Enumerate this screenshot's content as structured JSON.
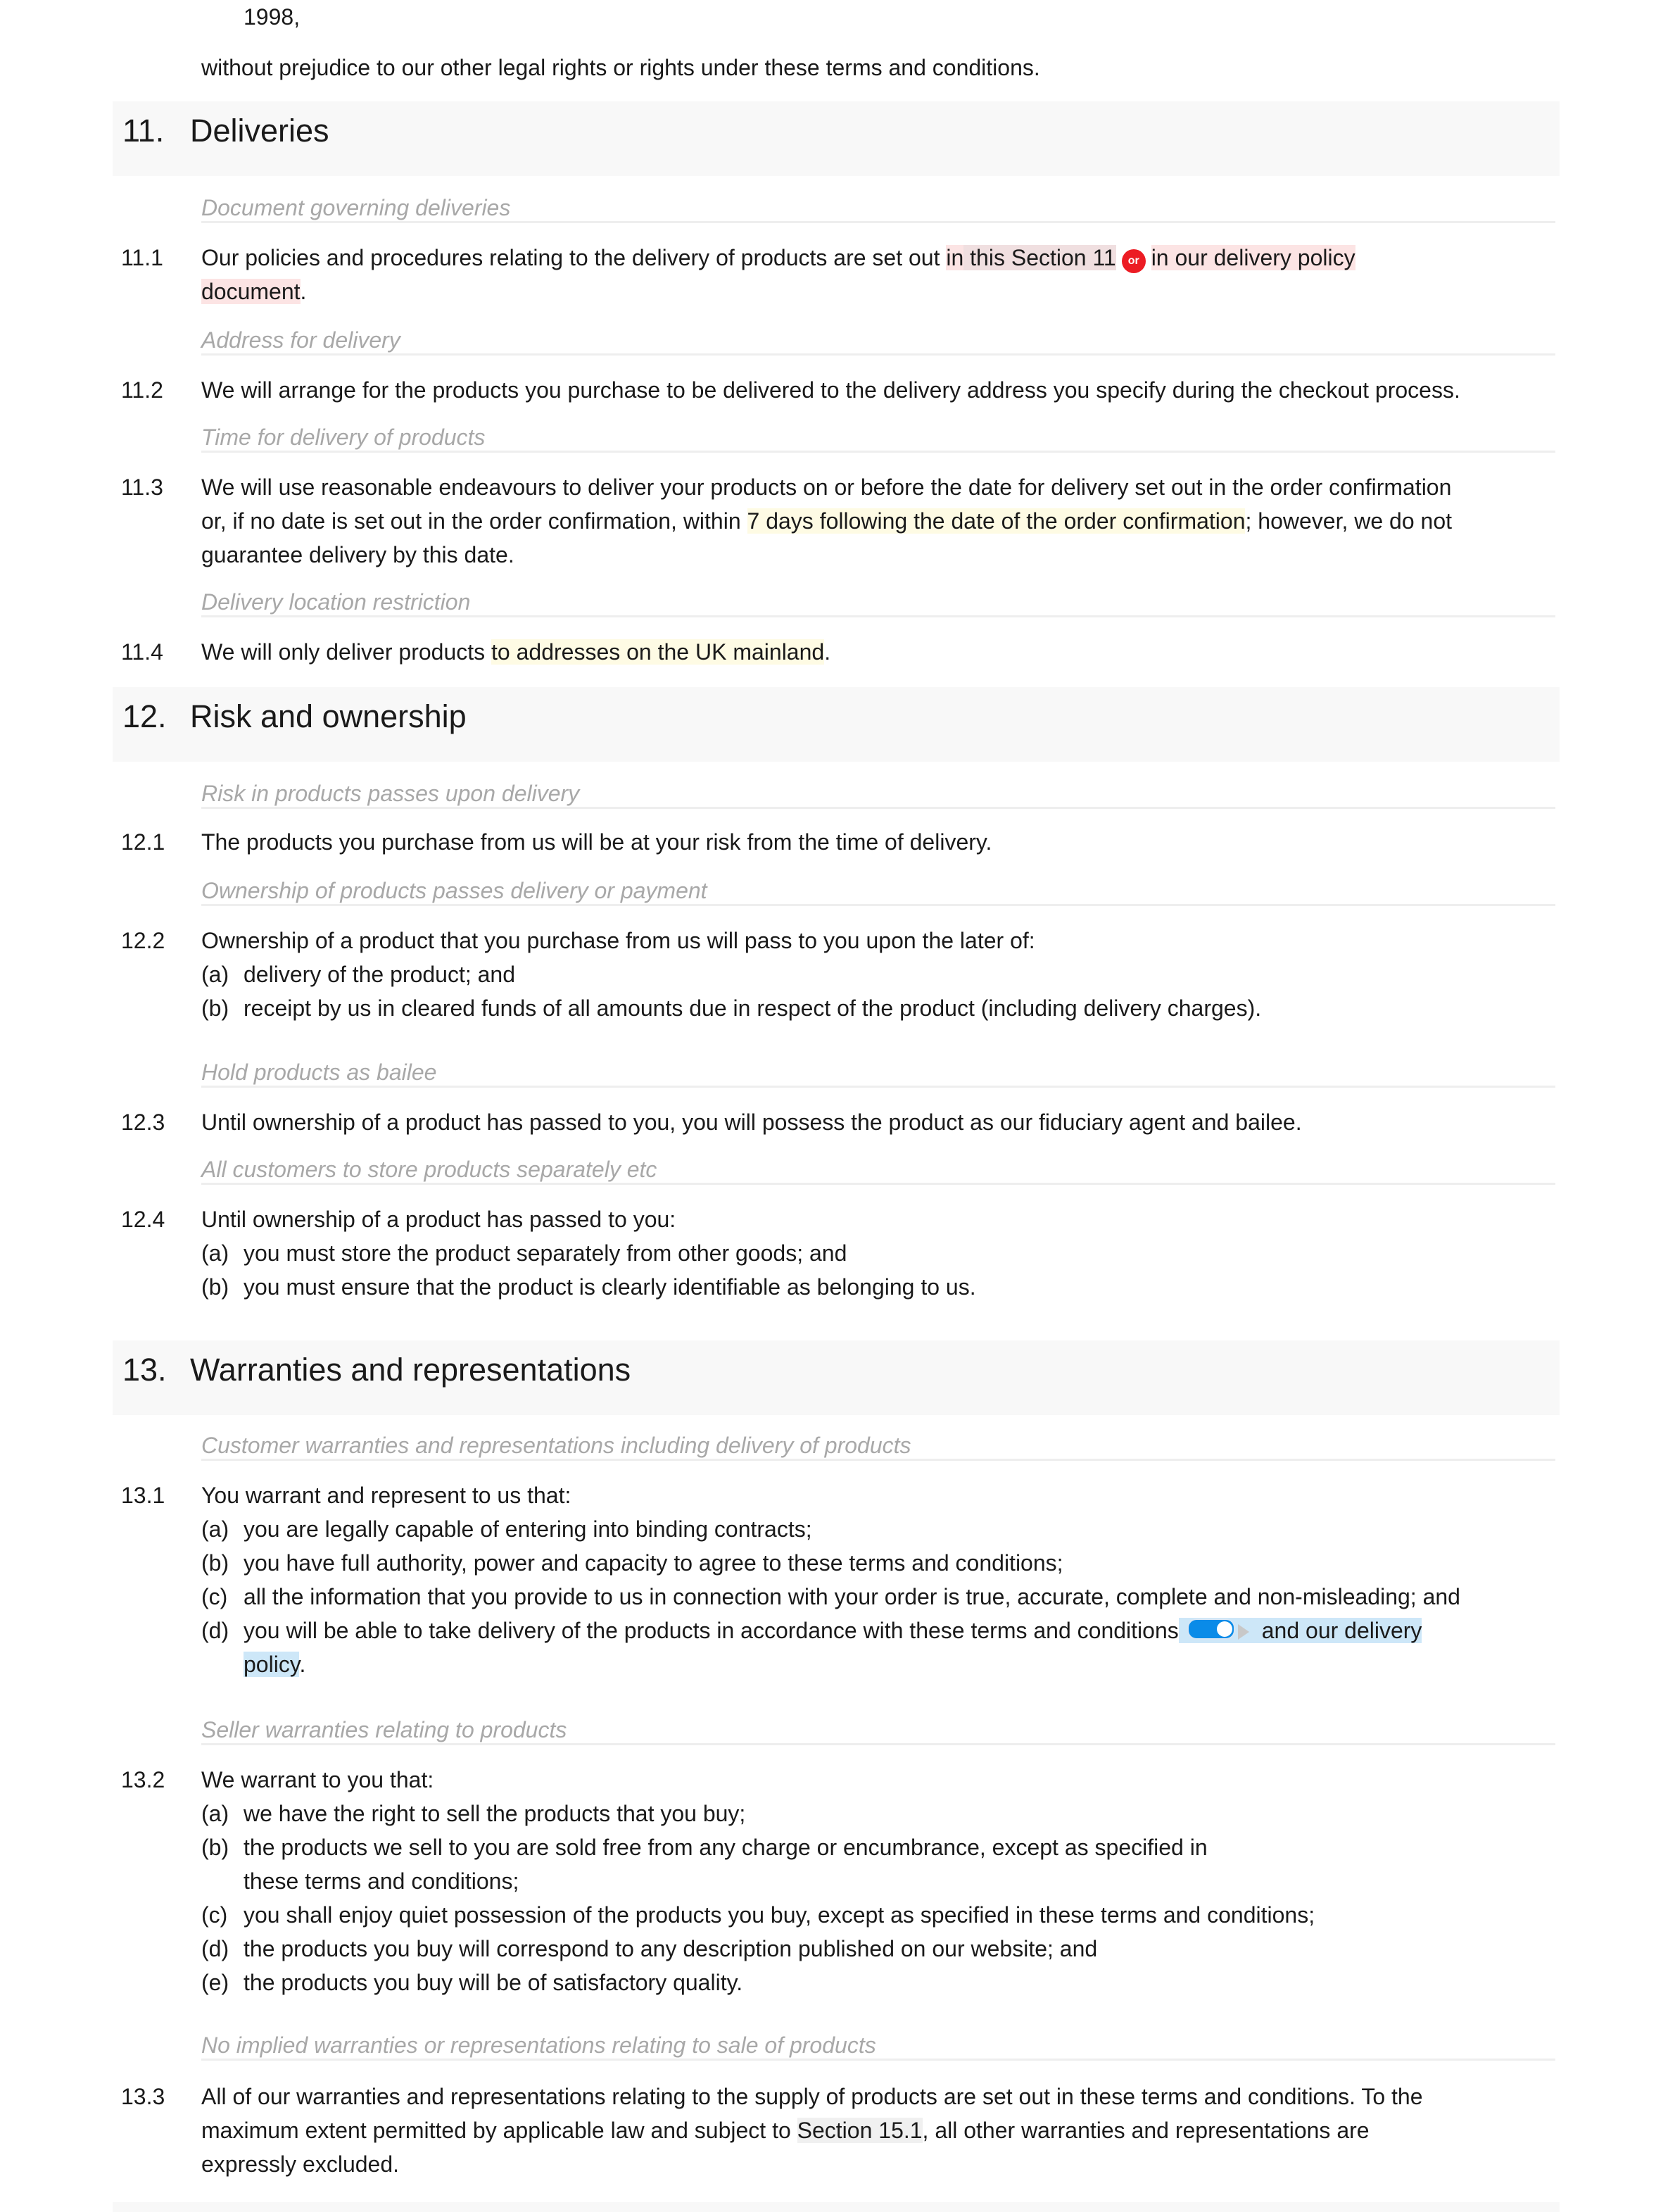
{
  "intro": {
    "item_fragment": "1998,",
    "closing_text": "without prejudice to our other legal rights or rights under these terms and conditions."
  },
  "sections": {
    "s11": {
      "num": "11.",
      "title": "Deliveries",
      "c1": {
        "subhead": "Document governing deliveries",
        "num": "11.1",
        "text_pre": "Our policies and procedures relating to the delivery of products are set out ",
        "option_a_1": "in",
        "option_a_2": " this Section 11",
        "or_badge": "or",
        "option_b": "in our delivery policy",
        "option_b_cont": "document",
        "text_post": "."
      },
      "c2": {
        "subhead": "Address for delivery",
        "num": "11.2",
        "text": "We will arrange for the products you purchase to be delivered to the delivery address you specify during the checkout process."
      },
      "c3": {
        "subhead": "Time for delivery of products",
        "num": "11.3",
        "line1": "We will use reasonable endeavours to deliver your products on or before the date for delivery set out in the order confirmation",
        "line2_pre": "or, if no date is set out in the order confirmation, within ",
        "line2_hl": "7 days following the date of the order confirmation",
        "line2_post": "; however, we do not",
        "line3": "guarantee delivery by this date."
      },
      "c4": {
        "subhead": "Delivery location restriction",
        "num": "11.4",
        "text_pre": "We will only deliver products ",
        "text_hl": "to addresses on the UK mainland",
        "text_post": "."
      }
    },
    "s12": {
      "num": "12.",
      "title": "Risk and ownership",
      "c1": {
        "subhead": "Risk in products passes upon delivery",
        "num": "12.1",
        "text": "The products you purchase from us will be at your risk from the time of delivery."
      },
      "c2": {
        "subhead": "Ownership of products passes delivery or payment",
        "num": "12.2",
        "text": "Ownership of a product that you purchase from us will pass to you upon the later of:",
        "items": [
          {
            "label": "(a)",
            "text": "delivery of the product; and"
          },
          {
            "label": "(b)",
            "text": "receipt by us in cleared funds of all amounts due in respect of the product (including delivery charges)."
          }
        ]
      },
      "c3": {
        "subhead": "Hold products as bailee",
        "num": "12.3",
        "text": "Until ownership of a product has passed to you, you will possess the product as our fiduciary agent and bailee."
      },
      "c4": {
        "subhead": "All customers to store products separately etc",
        "num": "12.4",
        "text": "Until ownership of a product has passed to you:",
        "items": [
          {
            "label": "(a)",
            "text": "you must store the product separately from other goods; and"
          },
          {
            "label": "(b)",
            "text": "you must ensure that the product is clearly identifiable as belonging to us."
          }
        ]
      }
    },
    "s13": {
      "num": "13.",
      "title": "Warranties and representations",
      "c1": {
        "subhead": "Customer warranties and representations including delivery of products",
        "num": "13.1",
        "text": "You warrant and represent to us that:",
        "items": [
          {
            "label": "(a)",
            "text": "you are legally capable of entering into binding contracts;"
          },
          {
            "label": "(b)",
            "text": "you have full authority, power and capacity to agree to these terms and conditions;"
          },
          {
            "label": "(c)",
            "text": "all the information that you provide to us in connection with your order is true, accurate, complete and non-misleading; and"
          }
        ],
        "item_d": {
          "label": "(d)",
          "text_pre": "you will be able to take delivery of the products in accordance with these terms and conditions",
          "optional_text": "and our delivery",
          "optional_text_cont": "policy",
          "text_post": ".",
          "toggle_on": true
        }
      },
      "c2": {
        "subhead": "Seller warranties relating to products",
        "num": "13.2",
        "text": "We warrant to you that:",
        "items": [
          {
            "label": "(a)",
            "text": "we have the right to sell the products that you buy;"
          },
          {
            "label": "(b)",
            "text": "the products we sell to you are sold free from any charge or encumbrance, except as specified in",
            "cont": "these terms and conditions;"
          },
          {
            "label": "(c)",
            "text": "you shall enjoy quiet possession of the products you buy, except as specified in these terms and conditions;"
          },
          {
            "label": "(d)",
            "text": "the products you buy will correspond to any description published on our website; and"
          },
          {
            "label": "(e)",
            "text": "the products you buy will be of satisfactory quality."
          }
        ]
      },
      "c3": {
        "subhead": "No implied warranties or representations relating to sale of products",
        "num": "13.3",
        "line1": "All of our warranties and representations relating to the supply of products are set out in these terms and conditions. To the",
        "line2_pre": "maximum extent permitted by applicable law and subject to ",
        "line2_ref": "Section 15.1",
        "line2_post": ", all other warranties and representations are",
        "line3": "expressly excluded."
      }
    }
  }
}
